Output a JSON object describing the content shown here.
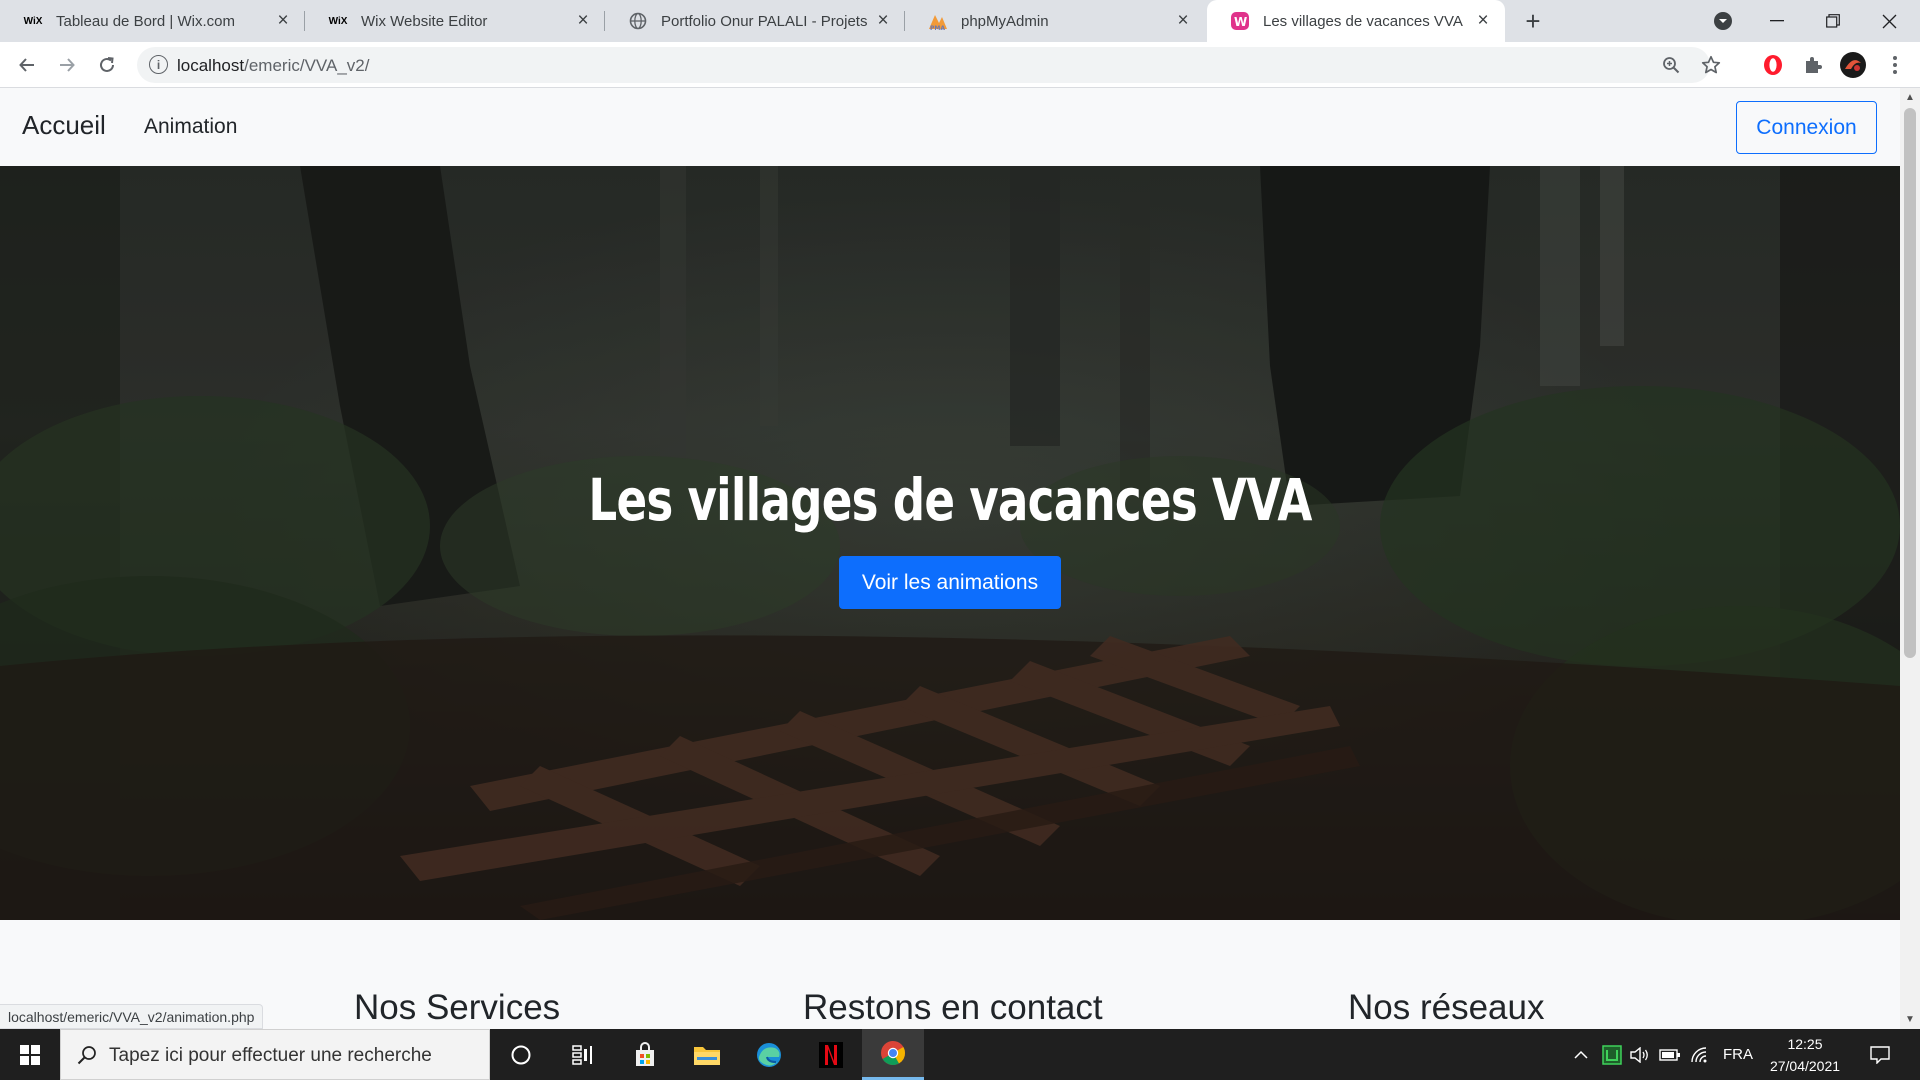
{
  "browser": {
    "tabs": [
      {
        "title": "Tableau de Bord | Wix.com",
        "favicon": "wix-icon",
        "active": false
      },
      {
        "title": "Wix Website Editor",
        "favicon": "wix-icon",
        "active": false
      },
      {
        "title": "Portfolio Onur PALALI - Projets",
        "favicon": "globe-icon",
        "active": false
      },
      {
        "title": "phpMyAdmin",
        "favicon": "phpmyadmin-icon",
        "active": false
      },
      {
        "title": "Les villages de vacances VVA",
        "favicon": "site-icon",
        "active": true
      }
    ],
    "address": {
      "host": "localhost",
      "path": "/emeric/VVA_v2/"
    },
    "status_url": "localhost/emeric/VVA_v2/animation.php"
  },
  "site": {
    "brand": "Accueil",
    "nav_link": "Animation",
    "login_button": "Connexion",
    "hero_title": "Les villages de vacances VVA",
    "hero_button": "Voir les animations",
    "footer_headings": [
      "Nos Services",
      "Restons en contact",
      "Nos réseaux"
    ]
  },
  "taskbar": {
    "search_placeholder": "Tapez ici pour effectuer une recherche",
    "language": "FRA",
    "time": "12:25",
    "date": "27/04/2021"
  },
  "colors": {
    "accent": "#0d6efd",
    "tabstrip": "#dee1e6",
    "taskbar": "#1f1f1f"
  }
}
